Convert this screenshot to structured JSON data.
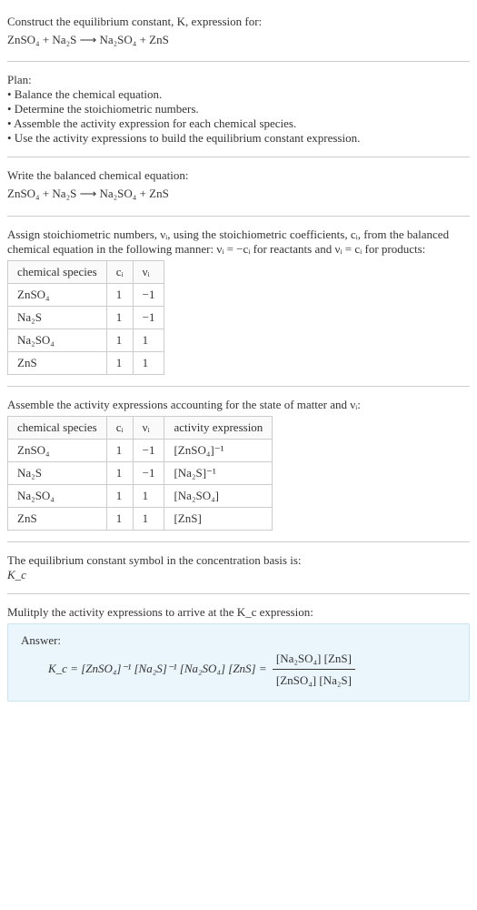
{
  "title_line1": "Construct the equilibrium constant, K, expression for:",
  "title_eq": "ZnSO₄ + Na₂S ⟶ Na₂SO₄ + ZnS",
  "plan_heading": "Plan:",
  "plan_items": [
    "• Balance the chemical equation.",
    "• Determine the stoichiometric numbers.",
    "• Assemble the activity expression for each chemical species.",
    "• Use the activity expressions to build the equilibrium constant expression."
  ],
  "balanced_heading": "Write the balanced chemical equation:",
  "balanced_eq": "ZnSO₄ + Na₂S ⟶ Na₂SO₄ + ZnS",
  "assign_text_1": "Assign stoichiometric numbers, νᵢ, using the stoichiometric coefficients, cᵢ, from the balanced chemical equation in the following manner: νᵢ = −cᵢ for reactants and νᵢ = cᵢ for products:",
  "table1": {
    "headers": [
      "chemical species",
      "cᵢ",
      "νᵢ"
    ],
    "rows": [
      [
        "ZnSO₄",
        "1",
        "−1"
      ],
      [
        "Na₂S",
        "1",
        "−1"
      ],
      [
        "Na₂SO₄",
        "1",
        "1"
      ],
      [
        "ZnS",
        "1",
        "1"
      ]
    ]
  },
  "assemble_text": "Assemble the activity expressions accounting for the state of matter and νᵢ:",
  "table2": {
    "headers": [
      "chemical species",
      "cᵢ",
      "νᵢ",
      "activity expression"
    ],
    "rows": [
      [
        "ZnSO₄",
        "1",
        "−1",
        "[ZnSO₄]⁻¹"
      ],
      [
        "Na₂S",
        "1",
        "−1",
        "[Na₂S]⁻¹"
      ],
      [
        "Na₂SO₄",
        "1",
        "1",
        "[Na₂SO₄]"
      ],
      [
        "ZnS",
        "1",
        "1",
        "[ZnS]"
      ]
    ]
  },
  "symbol_text_1": "The equilibrium constant symbol in the concentration basis is:",
  "symbol_text_2": "K_c",
  "multiply_text": "Mulitply the activity expressions to arrive at the K_c expression:",
  "answer_label": "Answer:",
  "answer_lhs": "K_c = [ZnSO₄]⁻¹ [Na₂S]⁻¹ [Na₂SO₄] [ZnS] =",
  "answer_num": "[Na₂SO₄] [ZnS]",
  "answer_den": "[ZnSO₄] [Na₂S]"
}
